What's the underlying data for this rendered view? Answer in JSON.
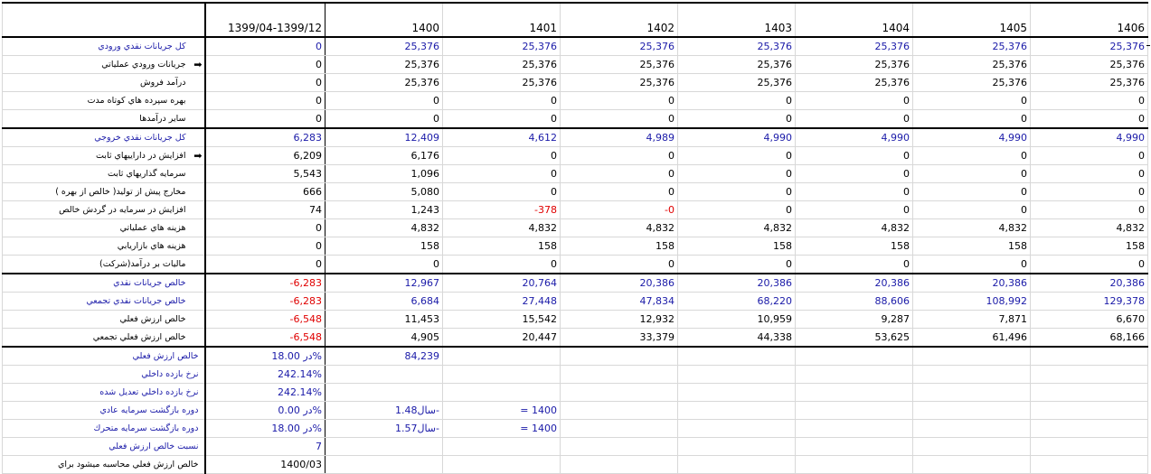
{
  "header": [
    "",
    "1399/04-1399/12",
    "1400",
    "1401",
    "1402",
    "1403",
    "1404",
    "1405",
    "1406"
  ],
  "rows": [
    {
      "label": "کل جریانات نقدي ورودي",
      "color": "blue",
      "arrow": false,
      "values": [
        "0",
        "25,376",
        "25,376",
        "25,376",
        "25,376",
        "25,376",
        "25,376",
        "25,376"
      ]
    },
    {
      "label": "جریانات ورودي عملیاتي",
      "color": "",
      "arrow": true,
      "values": [
        "0",
        "25,376",
        "25,376",
        "25,376",
        "25,376",
        "25,376",
        "25,376",
        "25,376"
      ]
    },
    {
      "label": "درآمد فروش",
      "color": "",
      "arrow": false,
      "values": [
        "0",
        "25,376",
        "25,376",
        "25,376",
        "25,376",
        "25,376",
        "25,376",
        "25,376"
      ]
    },
    {
      "label": "بهره سپرده هاي كوتاه مدت",
      "color": "",
      "arrow": false,
      "values": [
        "0",
        "0",
        "0",
        "0",
        "0",
        "0",
        "0",
        "0"
      ]
    },
    {
      "label": "ساير درآمدها",
      "color": "",
      "arrow": false,
      "values": [
        "0",
        "0",
        "0",
        "0",
        "0",
        "0",
        "0",
        "0"
      ]
    },
    {
      "label": "كل جريانات نقدي خروجي",
      "color": "blue",
      "arrow": false,
      "values": [
        "6,283",
        "12,409",
        "4,612",
        "4,989",
        "4,990",
        "4,990",
        "4,990",
        "4,990"
      ]
    },
    {
      "label": "افزايش در داراييهاي ثابت",
      "color": "",
      "arrow": true,
      "values": [
        "6,209",
        "6,176",
        "0",
        "0",
        "0",
        "0",
        "0",
        "0"
      ]
    },
    {
      "label": "سرمايه گذاريهاي ثابت",
      "color": "",
      "arrow": false,
      "values": [
        "5,543",
        "1,096",
        "0",
        "0",
        "0",
        "0",
        "0",
        "0"
      ]
    },
    {
      "label": "مخارج پيش از توليد( خالص از بهره )",
      "color": "",
      "arrow": false,
      "values": [
        "666",
        "5,080",
        "0",
        "0",
        "0",
        "0",
        "0",
        "0"
      ]
    },
    {
      "label": "افزايش در سرمايه در گردش خالص",
      "color": "",
      "arrow": false,
      "values": [
        "74",
        "1,243",
        "-378",
        "-0",
        "0",
        "0",
        "0",
        "0"
      ]
    },
    {
      "label": "هزينه هاي عملياتي",
      "color": "",
      "arrow": false,
      "values": [
        "0",
        "4,832",
        "4,832",
        "4,832",
        "4,832",
        "4,832",
        "4,832",
        "4,832"
      ]
    },
    {
      "label": "هزينه هاي بازاريابي",
      "color": "",
      "arrow": false,
      "values": [
        "0",
        "158",
        "158",
        "158",
        "158",
        "158",
        "158",
        "158"
      ]
    },
    {
      "label": "ماليات بر درآمد(شركت)",
      "color": "",
      "arrow": false,
      "values": [
        "0",
        "0",
        "0",
        "0",
        "0",
        "0",
        "0",
        "0"
      ]
    },
    {
      "label": "خالص جريانات نقدي",
      "color": "blue",
      "arrow": false,
      "values": [
        "-6,283",
        "12,967",
        "20,764",
        "20,386",
        "20,386",
        "20,386",
        "20,386",
        "20,386"
      ]
    },
    {
      "label": "خالص جريانات نقدي تجمعي",
      "color": "blue",
      "arrow": false,
      "values": [
        "-6,283",
        "6,684",
        "27,448",
        "47,834",
        "68,220",
        "88,606",
        "108,992",
        "129,378"
      ]
    },
    {
      "label": "خالص ارزش فعلي",
      "color": "",
      "arrow": false,
      "values": [
        "-6,548",
        "11,453",
        "15,542",
        "12,932",
        "10,959",
        "9,287",
        "7,871",
        "6,670"
      ]
    },
    {
      "label": "خالص ارزش فعلي تجمعي",
      "color": "",
      "arrow": false,
      "values": [
        "-6,548",
        "4,905",
        "20,447",
        "33,379",
        "44,338",
        "53,625",
        "61,496",
        "68,166"
      ]
    }
  ],
  "summary": [
    {
      "label": "خالص ارزش فعلي",
      "c1": "در 18.00%",
      "c2": "84,239",
      "c3": "",
      "color": "blue"
    },
    {
      "label": "نرخ بازده داخلي",
      "c1": "242.14%",
      "c2": "",
      "c3": "",
      "color": "blue"
    },
    {
      "label": "نرخ بازده داخلي تعديل شده",
      "c1": "242.14%",
      "c2": "",
      "c3": "",
      "color": "blue"
    },
    {
      "label": "دوره بازگشت سرمايه عادي",
      "c1": "در 0.00%",
      "c2": "1.48سال-",
      "c3": "= 1400",
      "color": "blue"
    },
    {
      "label": "دوره بازگشت سرمايه متحرك",
      "c1": "در 18.00%",
      "c2": "1.57سال-",
      "c3": "= 1400",
      "color": "blue"
    },
    {
      "label": "نسبت خالص ارزش فعلي",
      "c1": "7",
      "c2": "",
      "c3": "",
      "color": "blue"
    },
    {
      "label": "خالص ارزش فعلي محاسبه ميشود براي",
      "c1": "1400/03",
      "c2": "",
      "c3": "",
      "color": ""
    }
  ]
}
